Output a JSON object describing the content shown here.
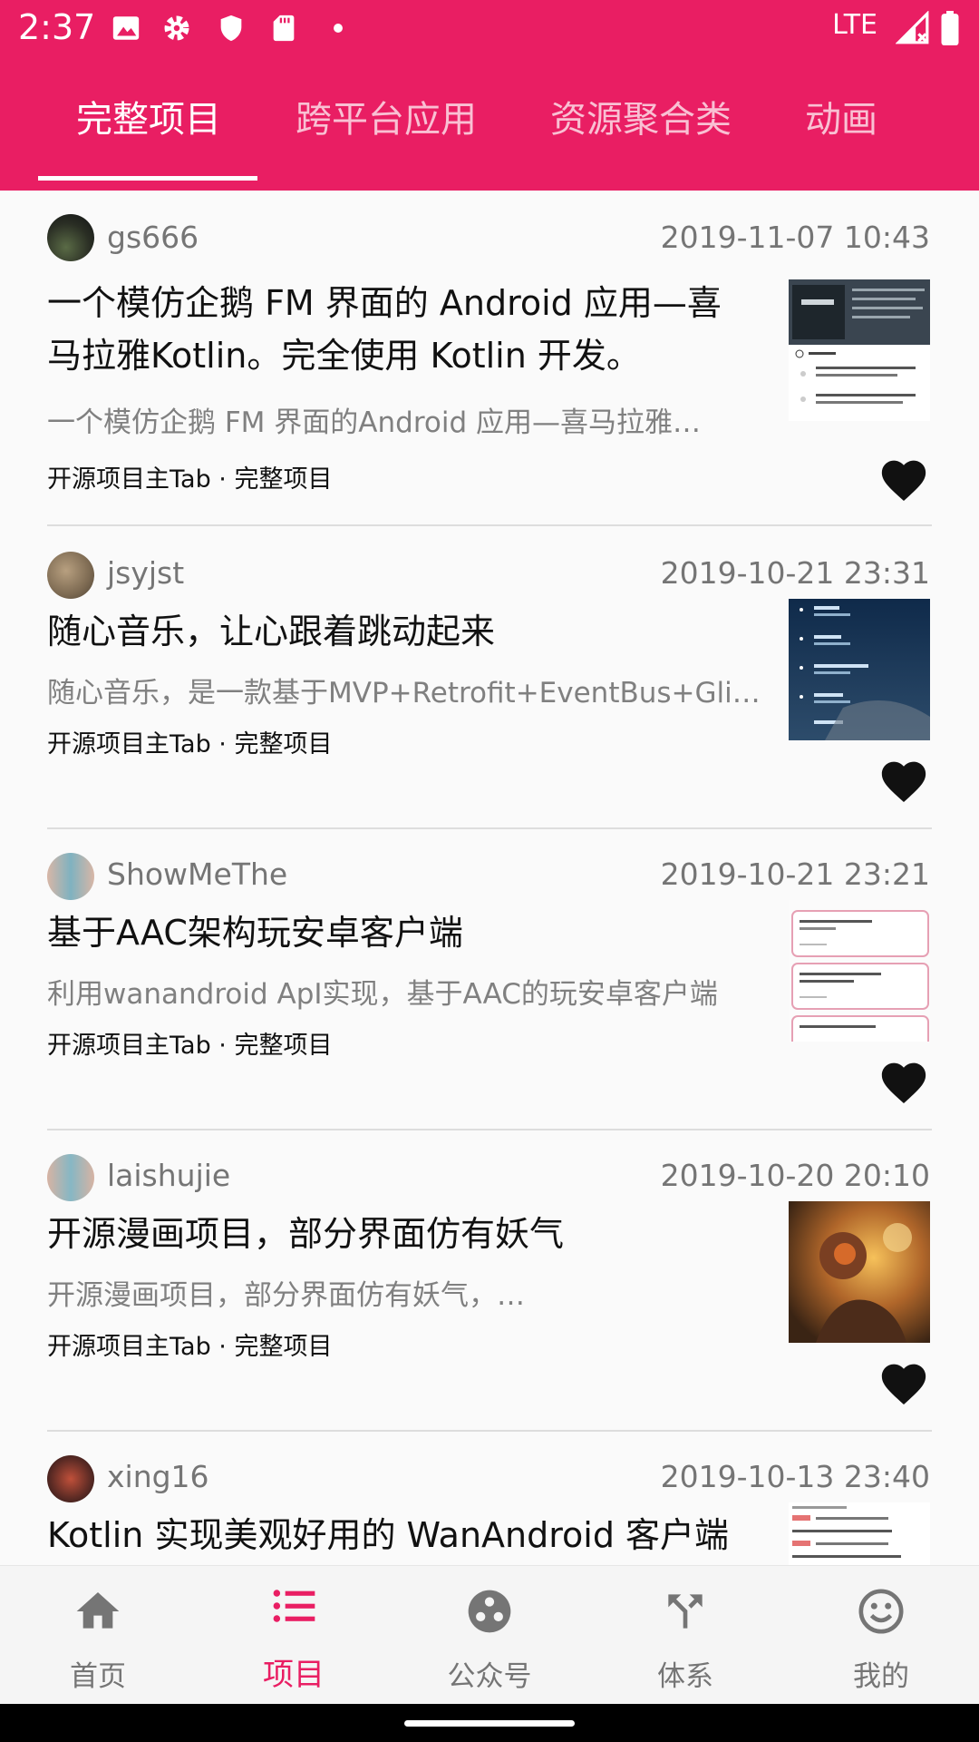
{
  "status_bar": {
    "time": "2:37",
    "network": "LTE",
    "icons": [
      "image-icon",
      "settings-icon",
      "shield-icon",
      "sd-card-icon",
      "dot-icon",
      "signal-icon",
      "battery-icon"
    ]
  },
  "tabs": [
    {
      "label": "完整项目",
      "active": true
    },
    {
      "label": "跨平台应用",
      "active": false
    },
    {
      "label": "资源聚合类",
      "active": false
    },
    {
      "label": "动画",
      "active": false
    }
  ],
  "colors": {
    "accent": "#e91e63",
    "divider": "#dddddd"
  },
  "items": [
    {
      "author": "gs666",
      "date": "2019-11-07 10:43",
      "title": "一个模仿企鹅 FM 界面的 Android 应用—喜马拉雅Kotlin。完全使用 Kotlin 开发。",
      "desc": "一个模仿企鹅 FM 界面的Android 应用—喜马拉雅…",
      "chapter": "开源项目主Tab · 完整项目"
    },
    {
      "author": "jsyjst",
      "date": "2019-10-21 23:31",
      "title": "随心音乐，让心跟着跳动起来",
      "desc": "随心音乐，是一款基于MVP+Retrofit+EventBus+Gli…",
      "chapter": "开源项目主Tab · 完整项目"
    },
    {
      "author": "ShowMeThe",
      "date": "2019-10-21 23:21",
      "title": "基于AAC架构玩安卓客户端",
      "desc": "利用wanandroid ApI实现，基于AAC的玩安卓客户端",
      "chapter": "开源项目主Tab · 完整项目"
    },
    {
      "author": "laishujie",
      "date": "2019-10-20 20:10",
      "title": "开源漫画项目，部分界面仿有妖气",
      "desc": "开源漫画项目，部分界面仿有妖气，…",
      "chapter": "开源项目主Tab · 完整项目"
    },
    {
      "author": "xing16",
      "date": "2019-10-13 23:40",
      "title": "Kotlin 实现美观好用的 WanAndroid 客户端",
      "desc": "",
      "chapter": ""
    }
  ],
  "bottom_nav": [
    {
      "label": "首页",
      "icon": "home-icon",
      "active": false
    },
    {
      "label": "项目",
      "icon": "list-icon",
      "active": true
    },
    {
      "label": "公众号",
      "icon": "group-icon",
      "active": false
    },
    {
      "label": "体系",
      "icon": "fork-icon",
      "active": false
    },
    {
      "label": "我的",
      "icon": "smiley-icon",
      "active": false
    }
  ]
}
